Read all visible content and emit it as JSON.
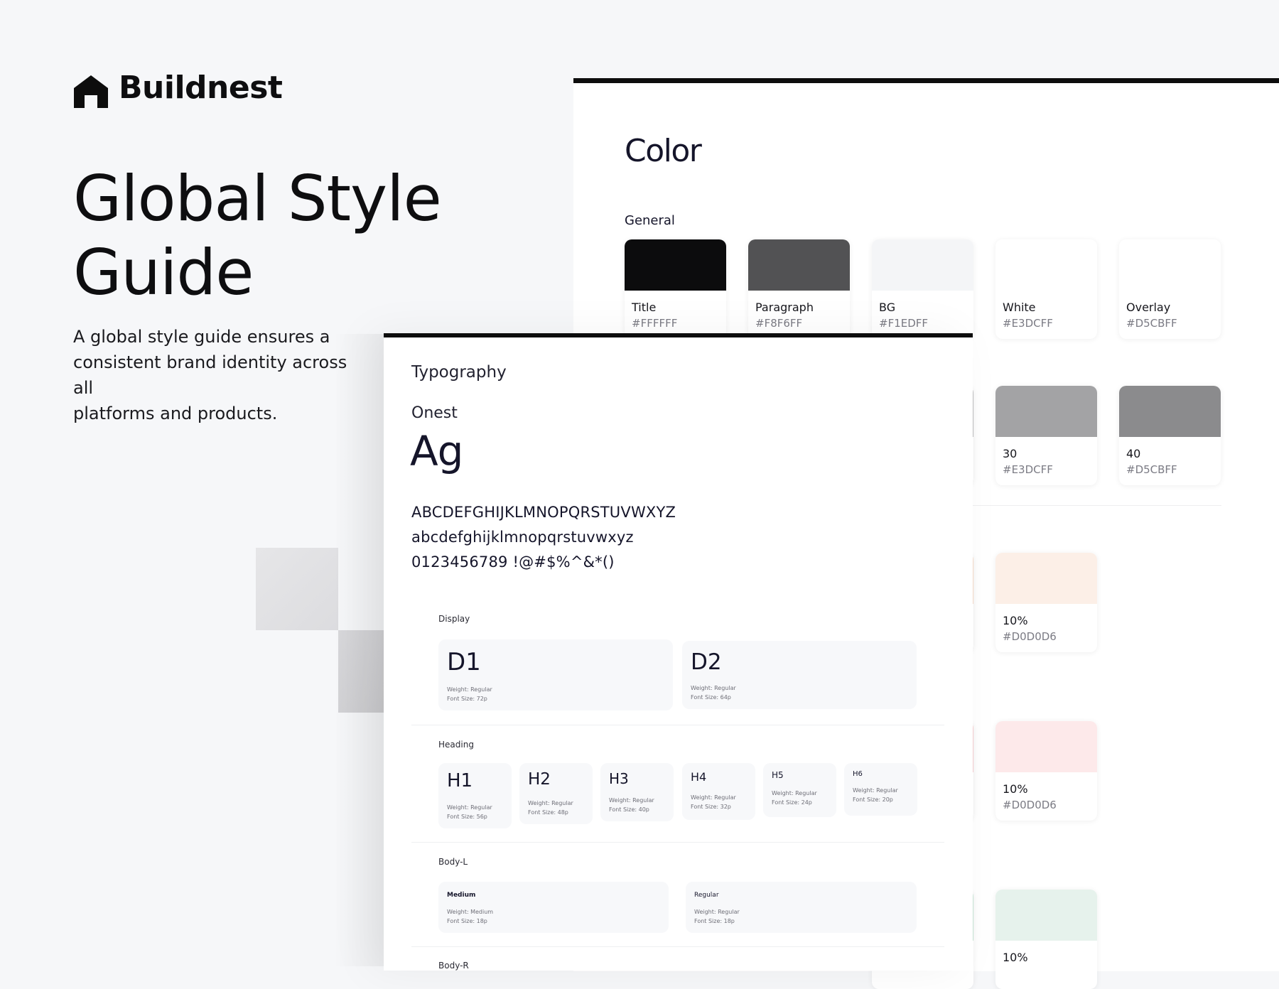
{
  "brand": {
    "name": "Buildnest"
  },
  "hero": {
    "title_lines": [
      "Global Style",
      "Guide"
    ],
    "description_lines": [
      "A global style guide ensures a",
      "consistent brand identity across all",
      "platforms and products."
    ]
  },
  "color_section": {
    "title": "Color",
    "general_label": "General",
    "general": [
      {
        "name": "Title",
        "hex": "#FFFFFF",
        "color": "#0c0c0d"
      },
      {
        "name": "Paragraph",
        "hex": "#F8F6FF",
        "color": "#525254"
      },
      {
        "name": "BG",
        "hex": "#F1EDFF",
        "color": "#f4f5f7"
      },
      {
        "name": "White",
        "hex": "#E3DCFF",
        "color": "#ffffff"
      },
      {
        "name": "Overlay",
        "hex": "#D5CBFF",
        "color": "#ffffff"
      }
    ],
    "grays": [
      {
        "name": "30",
        "hex": "#E3DCFF",
        "color": "#a3a3a5"
      },
      {
        "name": "40",
        "hex": "#D5CBFF",
        "color": "#8b8b8d"
      }
    ],
    "tints": [
      {
        "name": "10%",
        "hex": "#D0D0D6",
        "color": "#fcefe7"
      },
      {
        "name": "10%",
        "hex": "#D0D0D6",
        "color": "#fde9ea"
      },
      {
        "name": "10%",
        "hex": "",
        "color": "#e6f2ec"
      }
    ]
  },
  "typography": {
    "title": "Typography",
    "font_name": "Onest",
    "specimen": "Ag",
    "uppercase": "ABCDEFGHIJKLMNOPQRSTUVWXYZ",
    "lowercase": "abcdefghijklmnopqrstuvwxyz",
    "numbers": "0123456789 !@#$%^&*()",
    "display_label": "Display",
    "display": [
      {
        "label": "D1",
        "weight": "Weight: Regular",
        "size": "Font Size: 72p"
      },
      {
        "label": "D2",
        "weight": "Weight: Regular",
        "size": "Font Size: 64p"
      }
    ],
    "heading_label": "Heading",
    "headings": [
      {
        "label": "H1",
        "weight": "Weight: Regular",
        "size": "Font Size: 56p"
      },
      {
        "label": "H2",
        "weight": "Weight: Regular",
        "size": "Font Size: 48p"
      },
      {
        "label": "H3",
        "weight": "Weight: Regular",
        "size": "Font Size: 40p"
      },
      {
        "label": "H4",
        "weight": "Weight: Regular",
        "size": "Font Size: 32p"
      },
      {
        "label": "H5",
        "weight": "Weight: Regular",
        "size": "Font Size: 24p"
      },
      {
        "label": "H6",
        "weight": "Weight: Regular",
        "size": "Font Size: 20p"
      }
    ],
    "body_l_label": "Body-L",
    "body_l": [
      {
        "label": "Medium",
        "weight": "Weight: Medium",
        "size": "Font Size: 18p"
      },
      {
        "label": "Regular",
        "weight": "Weight: Regular",
        "size": "Font Size: 18p"
      }
    ],
    "body_r_label": "Body-R"
  }
}
